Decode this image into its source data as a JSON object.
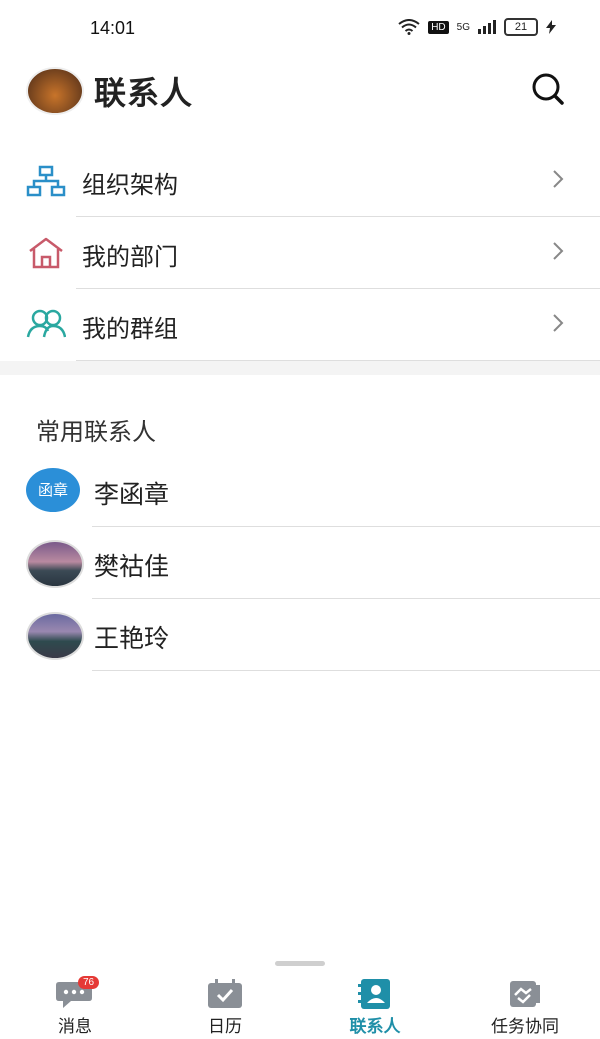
{
  "status": {
    "time": "14:01",
    "network": "5G",
    "hd": "HD",
    "battery": "21"
  },
  "header": {
    "title": "联系人"
  },
  "menu": [
    {
      "label": "组织架构",
      "icon": "org-chart-icon",
      "color": "#2a8fc8"
    },
    {
      "label": "我的部门",
      "icon": "home-icon",
      "color": "#c85a6a"
    },
    {
      "label": "我的群组",
      "icon": "group-icon",
      "color": "#2aa8a0"
    }
  ],
  "section": {
    "title": "常用联系人"
  },
  "contacts": [
    {
      "name": "李函章",
      "avatar_text": "函章"
    },
    {
      "name": "樊祜佳"
    },
    {
      "name": "王艳玲"
    }
  ],
  "tabs": [
    {
      "label": "消息",
      "badge": "76"
    },
    {
      "label": "日历"
    },
    {
      "label": "联系人",
      "active": true
    },
    {
      "label": "任务协同"
    }
  ],
  "colors": {
    "accent": "#1f8fa8",
    "badge": "#e53935"
  }
}
